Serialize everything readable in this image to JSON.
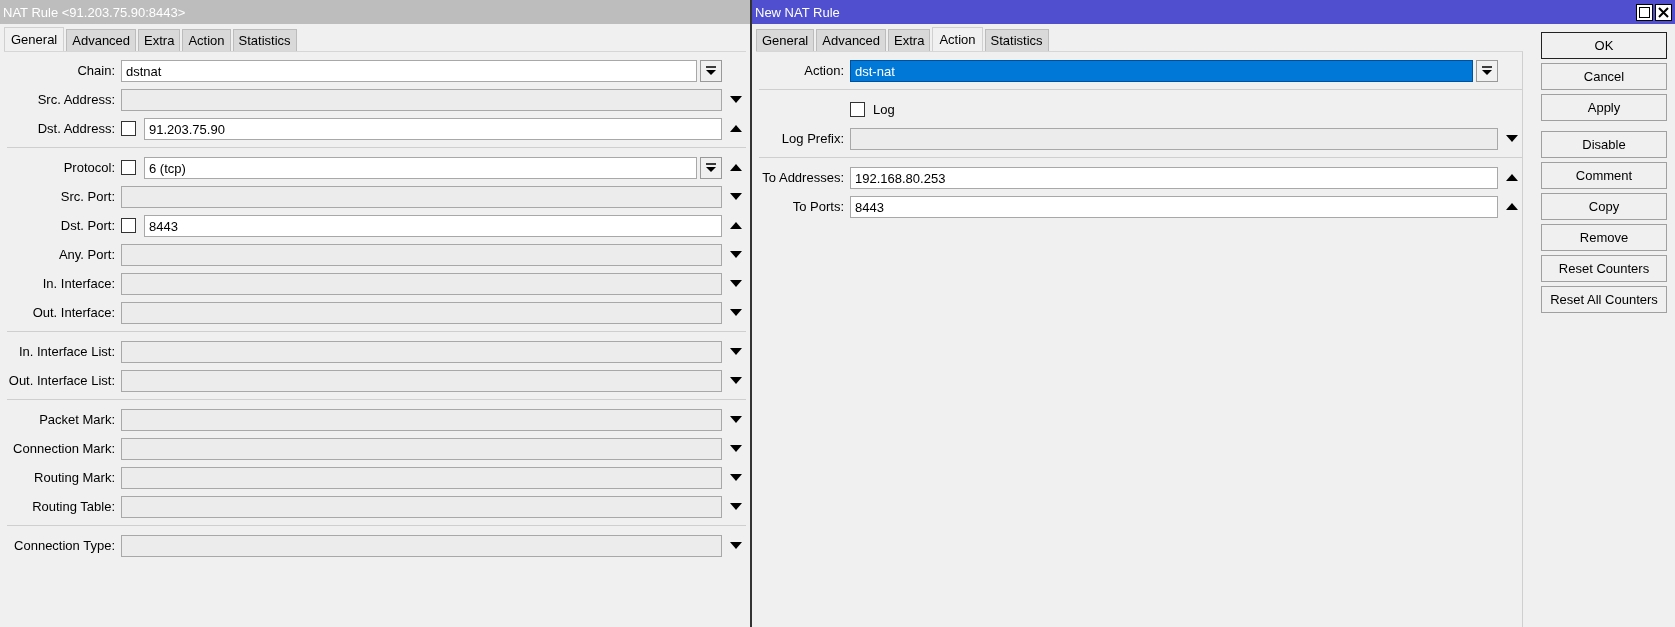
{
  "rule_window": {
    "title": "NAT Rule <91.203.75.90:8443>",
    "active": false,
    "tabs": [
      {
        "label": "General",
        "selected": true
      },
      {
        "label": "Advanced",
        "selected": false
      },
      {
        "label": "Extra",
        "selected": false
      },
      {
        "label": "Action",
        "selected": false
      },
      {
        "label": "Statistics",
        "selected": false
      }
    ],
    "groups": [
      [
        {
          "label": "Chain:",
          "kind": "combo",
          "value": "dstnat"
        },
        {
          "label": "Src. Address:",
          "kind": "text",
          "expanded": false
        },
        {
          "label": "Dst. Address:",
          "kind": "text",
          "negate": {
            "checked": false
          },
          "value": "91.203.75.90",
          "expanded": true
        }
      ],
      [
        {
          "label": "Protocol:",
          "kind": "combo",
          "negate": {
            "checked": false
          },
          "value": "6 (tcp)",
          "expanded": true
        },
        {
          "label": "Src. Port:",
          "kind": "text",
          "expanded": false
        },
        {
          "label": "Dst. Port:",
          "kind": "text",
          "negate": {
            "checked": false
          },
          "value": "8443",
          "expanded": true
        },
        {
          "label": "Any. Port:",
          "kind": "text",
          "expanded": false
        },
        {
          "label": "In. Interface:",
          "kind": "text",
          "expanded": false
        },
        {
          "label": "Out. Interface:",
          "kind": "text",
          "expanded": false
        }
      ],
      [
        {
          "label": "In. Interface List:",
          "kind": "text",
          "expanded": false
        },
        {
          "label": "Out. Interface List:",
          "kind": "text",
          "expanded": false
        }
      ],
      [
        {
          "label": "Packet Mark:",
          "kind": "text",
          "expanded": false
        },
        {
          "label": "Connection Mark:",
          "kind": "text",
          "expanded": false
        },
        {
          "label": "Routing Mark:",
          "kind": "text",
          "expanded": false
        },
        {
          "label": "Routing Table:",
          "kind": "text",
          "expanded": false
        }
      ],
      [
        {
          "label": "Connection Type:",
          "kind": "text",
          "expanded": false
        }
      ]
    ]
  },
  "new_rule_window": {
    "title": "New NAT Rule",
    "active": true,
    "tabs": [
      {
        "label": "General",
        "selected": false
      },
      {
        "label": "Advanced",
        "selected": false
      },
      {
        "label": "Extra",
        "selected": false
      },
      {
        "label": "Action",
        "selected": true
      },
      {
        "label": "Statistics",
        "selected": false
      }
    ],
    "groups": [
      [
        {
          "label": "Action:",
          "kind": "combo",
          "value": "dst-nat",
          "highlighted": true
        }
      ],
      [
        {
          "label": "Log",
          "kind": "checkbox",
          "checked": false
        },
        {
          "label": "Log Prefix:",
          "kind": "text",
          "expanded": false
        }
      ],
      [
        {
          "label": "To Addresses:",
          "kind": "text",
          "value": "192.168.80.253",
          "expanded": true
        },
        {
          "label": "To Ports:",
          "kind": "text",
          "value": "8443",
          "expanded": true
        }
      ]
    ],
    "buttons": [
      {
        "label": "OK",
        "default": true
      },
      {
        "label": "Cancel",
        "default": false
      },
      {
        "label": "Apply",
        "default": false
      },
      {
        "label": "Disable",
        "default": false
      },
      {
        "label": "Comment",
        "default": false
      },
      {
        "label": "Copy",
        "default": false
      },
      {
        "label": "Remove",
        "default": false
      },
      {
        "label": "Reset Counters",
        "default": false
      },
      {
        "label": "Reset All Counters",
        "default": false
      }
    ]
  }
}
